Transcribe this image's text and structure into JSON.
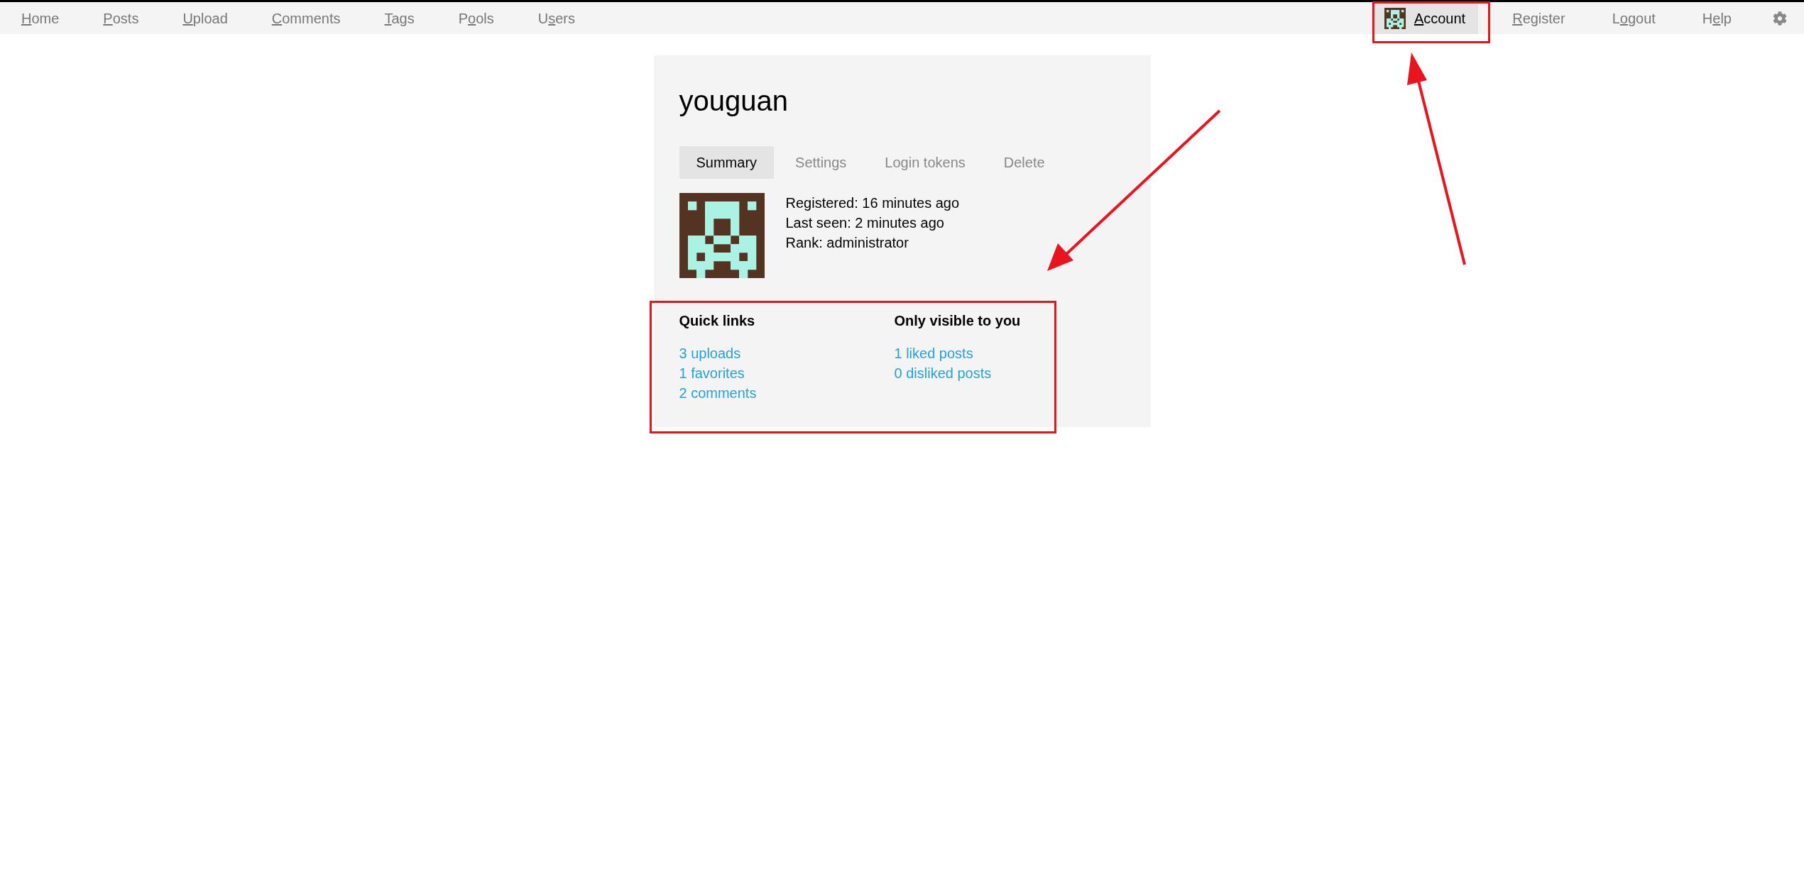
{
  "nav": {
    "left": [
      {
        "key": "H",
        "post": "ome",
        "selected": false
      },
      {
        "key": "P",
        "post": "osts",
        "selected": false
      },
      {
        "key": "U",
        "post": "pload",
        "selected": false
      },
      {
        "key": "C",
        "post": "omments",
        "selected": false
      },
      {
        "key": "T",
        "post": "ags",
        "selected": false
      },
      {
        "pre": "P",
        "key": "o",
        "post": "ols",
        "selected": false
      },
      {
        "pre": "U",
        "key": "s",
        "post": "ers",
        "selected": false
      }
    ],
    "right": [
      {
        "key": "A",
        "post": "ccount",
        "selected": true,
        "avatar": true
      },
      {
        "key": "R",
        "post": "egister",
        "selected": false
      },
      {
        "pre": "L",
        "key": "o",
        "post": "gout",
        "selected": false
      },
      {
        "pre": "H",
        "key": "e",
        "post": "lp",
        "selected": false
      }
    ]
  },
  "user": {
    "name": "youguan",
    "tabs": [
      {
        "label": "Summary",
        "selected": true
      },
      {
        "label": "Settings",
        "selected": false
      },
      {
        "label": "Login tokens",
        "selected": false
      },
      {
        "label": "Delete",
        "selected": false
      }
    ],
    "details": [
      "Registered: 16 minutes ago",
      "Last seen: 2 minutes ago",
      "Rank: administrator"
    ],
    "sections": [
      {
        "title": "Quick links",
        "links": [
          "3 uploads",
          "1 favorites",
          "2 comments"
        ]
      },
      {
        "title": "Only visible to you",
        "links": [
          "1 liked posts",
          "0 disliked posts"
        ]
      }
    ]
  }
}
